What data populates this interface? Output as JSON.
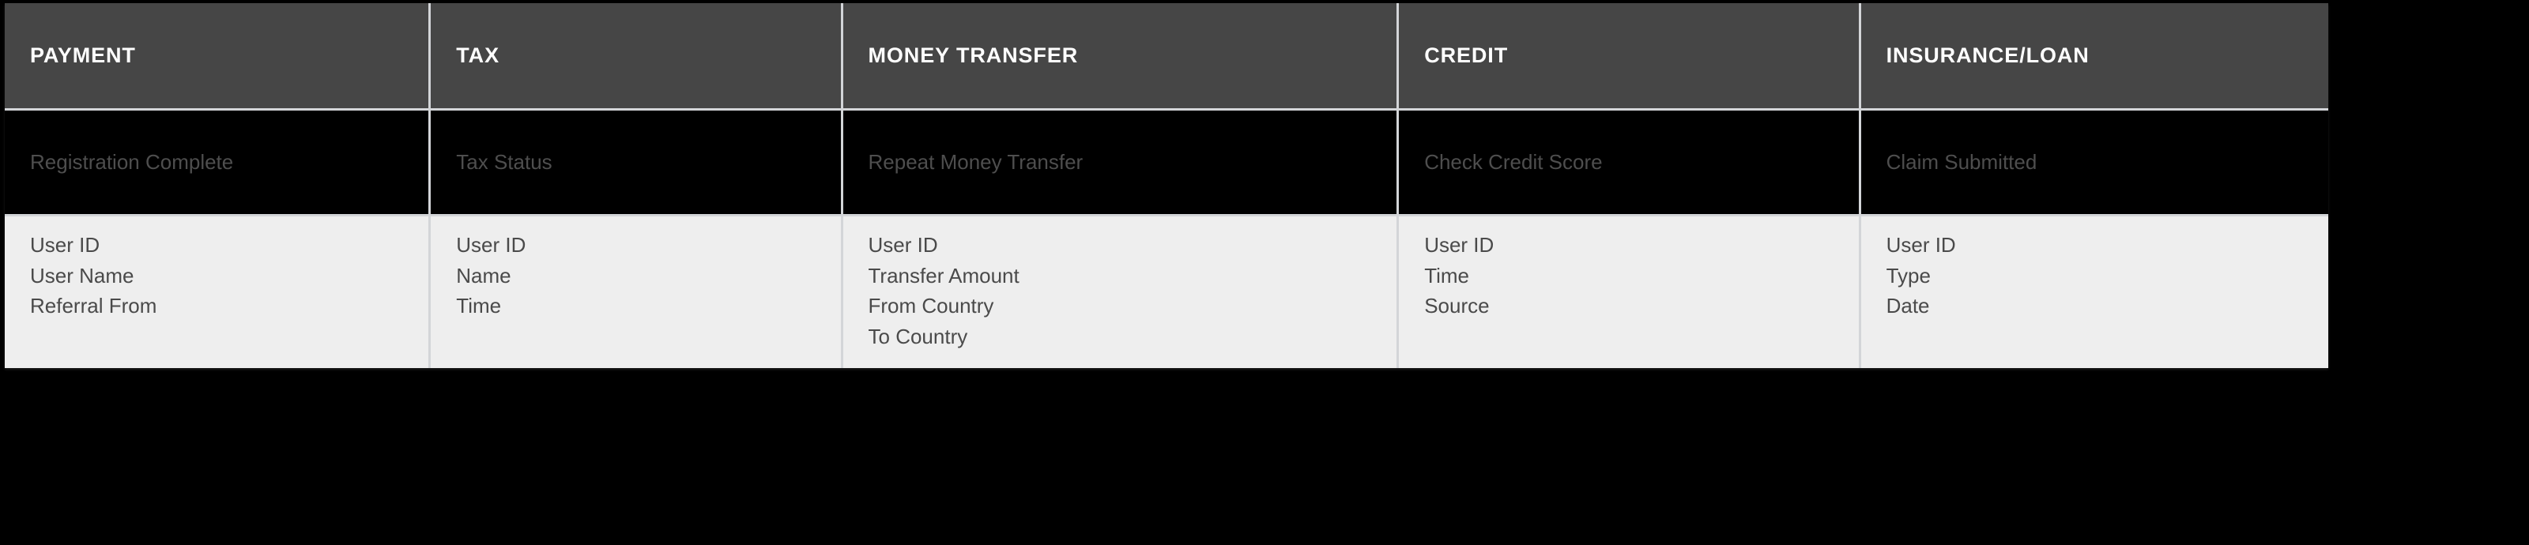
{
  "table": {
    "columns": [
      {
        "header": "PAYMENT",
        "event": "Registration Complete",
        "fields": [
          "User ID",
          "User Name",
          "Referral From"
        ]
      },
      {
        "header": "TAX",
        "event": "Tax Status",
        "fields": [
          "User ID",
          "Name",
          "Time"
        ]
      },
      {
        "header": "MONEY TRANSFER",
        "event": "Repeat Money Transfer",
        "fields": [
          "User ID",
          "Transfer Amount",
          "From Country",
          "To Country"
        ]
      },
      {
        "header": "CREDIT",
        "event": "Check Credit Score",
        "fields": [
          "User ID",
          "Time",
          "Source"
        ]
      },
      {
        "header": "INSURANCE/LOAN",
        "event": "Claim Submitted",
        "fields": [
          "User ID",
          "Type",
          "Date"
        ]
      }
    ]
  },
  "colors": {
    "header_background": "#464646",
    "header_text": "#ffffff",
    "event_row_background": "#000000",
    "event_row_text": "#4e4e4e",
    "fields_row_background": "#eeeeee",
    "fields_row_text": "#4a4a4a",
    "grid_line": "#d3d5d8",
    "page_background": "#000000"
  }
}
